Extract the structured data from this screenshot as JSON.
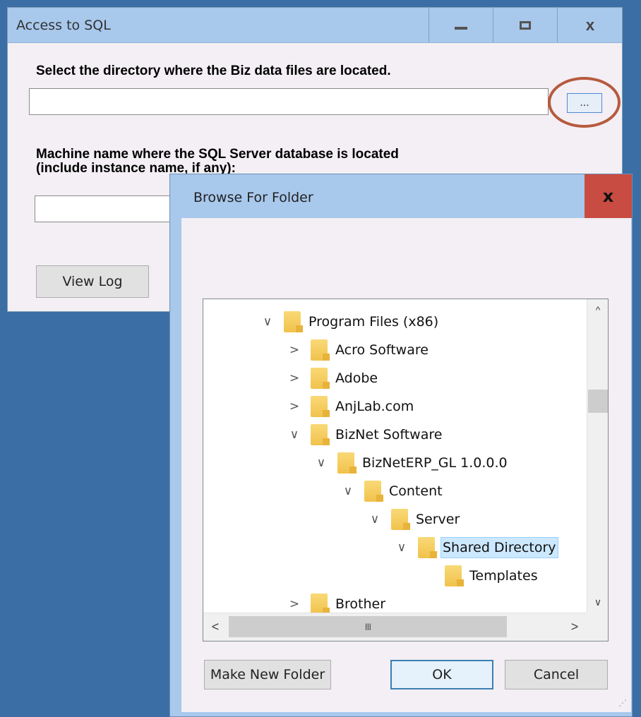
{
  "main_window": {
    "title": "Access to SQL",
    "minimize_label": "",
    "maximize_label": "",
    "close_label": "x",
    "dir_label": "Select the directory where the Biz data files are located.",
    "dir_value": "",
    "browse_label": "...",
    "machine_label_line1": "Machine name where the SQL Server database is located",
    "machine_label_line2": "(include instance name, if any):",
    "machine_value": "",
    "view_log_label": "View Log"
  },
  "browse_dialog": {
    "title": "Browse For Folder",
    "close_label": "x",
    "tree": [
      {
        "label": "Program Files (x86)",
        "chevron": "∨",
        "indent": 0
      },
      {
        "label": "Acro Software",
        "chevron": ">",
        "indent": 1
      },
      {
        "label": "Adobe",
        "chevron": ">",
        "indent": 1
      },
      {
        "label": "AnjLab.com",
        "chevron": ">",
        "indent": 1
      },
      {
        "label": "BizNet Software",
        "chevron": "∨",
        "indent": 1
      },
      {
        "label": "BizNetERP_GL 1.0.0.0",
        "chevron": "∨",
        "indent": 2
      },
      {
        "label": "Content",
        "chevron": "∨",
        "indent": 3
      },
      {
        "label": "Server",
        "chevron": "∨",
        "indent": 4
      },
      {
        "label": "Shared Directory",
        "chevron": "∨",
        "indent": 5,
        "selected": true
      },
      {
        "label": "Templates",
        "chevron": "",
        "indent": 6
      },
      {
        "label": "Brother",
        "chevron": ">",
        "indent": 1
      }
    ],
    "scroll_up": "^",
    "scroll_down": "∨",
    "scroll_left": "<",
    "scroll_right": ">",
    "thumb_grip": "III",
    "make_new_folder_label": "Make New Folder",
    "ok_label": "OK",
    "cancel_label": "Cancel"
  }
}
